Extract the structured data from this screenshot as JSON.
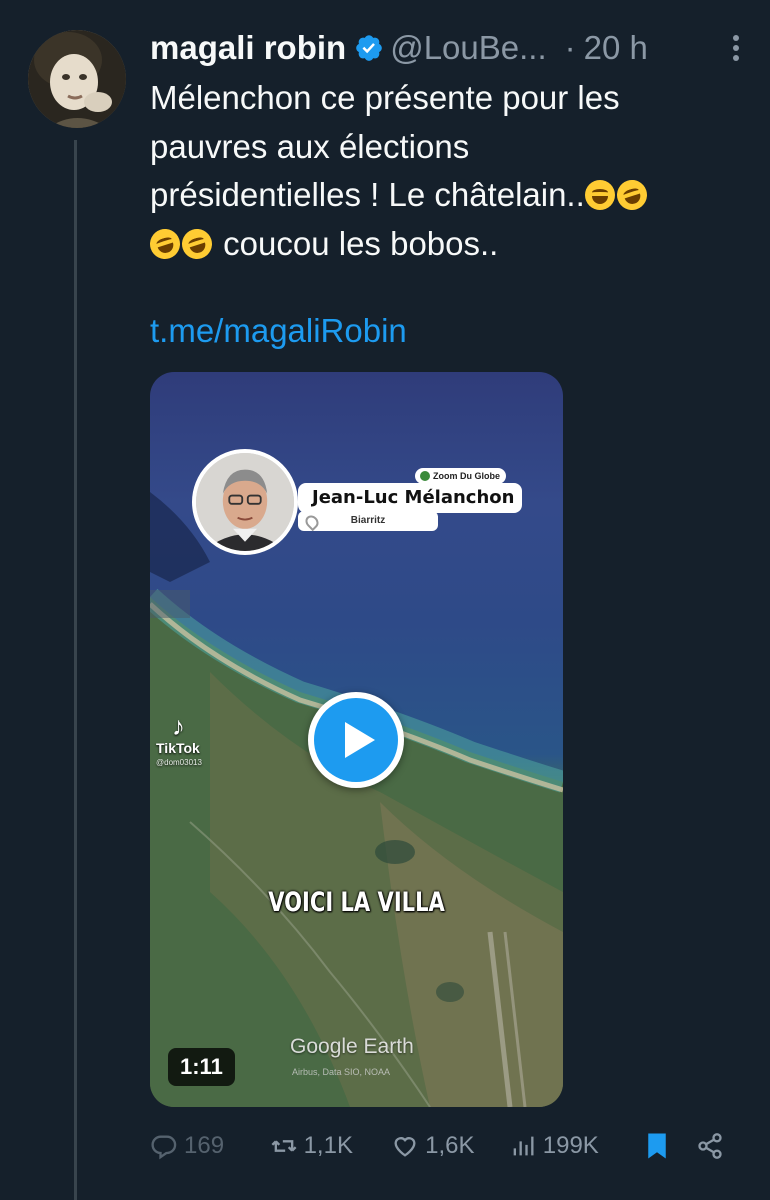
{
  "tweet": {
    "author_name": "magali robin",
    "handle": "@LouBe...",
    "separator": "·",
    "time": "20 h",
    "text_lines": [
      "Mélenchon ce présente pour les",
      "pauvres aux élections",
      "présidentielles ! Le châtelain..",
      "coucou les bobos.."
    ],
    "link": "t.me/magaliRobin"
  },
  "video": {
    "zoom_tag": "Zoom Du Globe",
    "person_name": "Jean-Luc Mélanchon",
    "location": "Biarritz",
    "tiktok_label": "TikTok",
    "tiktok_user": "@dom03013",
    "overlay_caption": "VOICI LA VILLA",
    "watermark": "Google Earth",
    "watermark_credit": "Airbus, Data SIO, NOAA",
    "duration": "1:11"
  },
  "actions": {
    "replies": "169",
    "retweets": "1,1K",
    "likes": "1,6K",
    "views": "199K"
  },
  "colors": {
    "background": "#15202b",
    "accent": "#1d9bf0",
    "muted": "#8b98a5"
  },
  "icons": {
    "verified": "verified-badge-icon",
    "more": "more-dots-icon",
    "reply": "reply-bubble-icon",
    "retweet": "retweet-arrows-icon",
    "like": "heart-icon",
    "views": "analytics-bars-icon",
    "bookmark": "bookmark-icon",
    "share": "share-icon",
    "play": "play-icon"
  }
}
